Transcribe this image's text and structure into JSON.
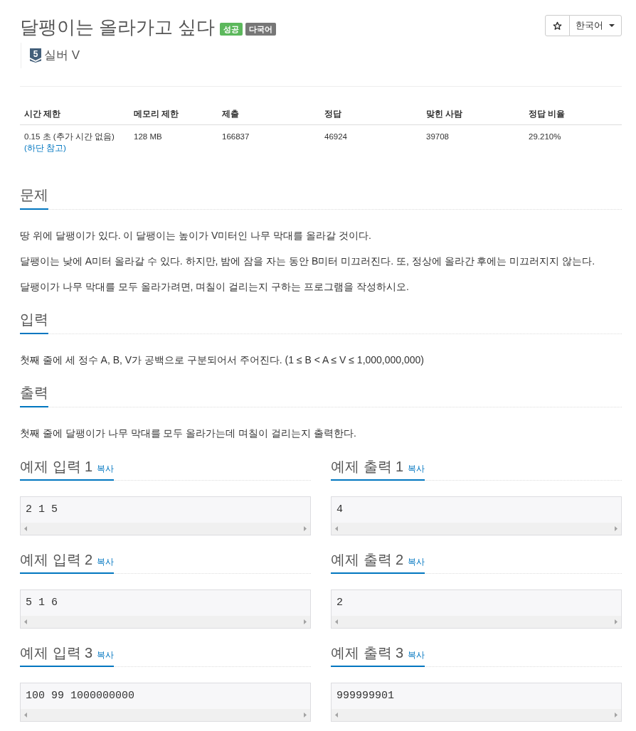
{
  "title": "달팽이는 올라가고 싶다",
  "badges": [
    {
      "label": "성공",
      "color": "#5cb85c"
    },
    {
      "label": "다국어",
      "color": "#777777"
    }
  ],
  "language_menu": {
    "label": "한국어"
  },
  "tier": {
    "number": "5",
    "label": "실버 V"
  },
  "info_table": {
    "columns": [
      "시간 제한",
      "메모리 제한",
      "제출",
      "정답",
      "맞힌 사람",
      "정답 비율"
    ],
    "rows": [
      {
        "cells": [
          "0.15 초 (추가 시간 없음)",
          "128 MB",
          "166837",
          "46924",
          "39708",
          "29.210%"
        ],
        "note_link": "(하단 참고)"
      }
    ]
  },
  "sections": [
    {
      "heading": "문제",
      "paragraphs": [
        "땅 위에 달팽이가 있다. 이 달팽이는 높이가 V미터인 나무 막대를 올라갈 것이다.",
        "달팽이는 낮에 A미터 올라갈 수 있다. 하지만, 밤에 잠을 자는 동안 B미터 미끄러진다. 또, 정상에 올라간 후에는 미끄러지지 않는다.",
        "달팽이가 나무 막대를 모두 올라가려면, 며칠이 걸리는지 구하는 프로그램을 작성하시오."
      ]
    },
    {
      "heading": "입력",
      "paragraphs": [
        "첫째 줄에 세 정수 A, B, V가 공백으로 구분되어서 주어진다. (1 ≤ B < A ≤ V ≤ 1,000,000,000)"
      ]
    },
    {
      "heading": "출력",
      "paragraphs": [
        "첫째 줄에 달팽이가 나무 막대를 모두 올라가는데 며칠이 걸리는지 출력한다."
      ]
    }
  ],
  "examples": [
    {
      "input": {
        "heading": "예제 입력 1",
        "copy_link": "복사",
        "data": "2 1 5"
      },
      "output": {
        "heading": "예제 출력 1",
        "copy_link": "복사",
        "data": "4"
      }
    },
    {
      "input": {
        "heading": "예제 입력 2",
        "copy_link": "복사",
        "data": "5 1 6"
      },
      "output": {
        "heading": "예제 출력 2",
        "copy_link": "복사",
        "data": "2"
      }
    },
    {
      "input": {
        "heading": "예제 입력 3",
        "copy_link": "복사",
        "data": "100 99 1000000000"
      },
      "output": {
        "heading": "예제 출력 3",
        "copy_link": "복사",
        "data": "999999901"
      }
    }
  ]
}
